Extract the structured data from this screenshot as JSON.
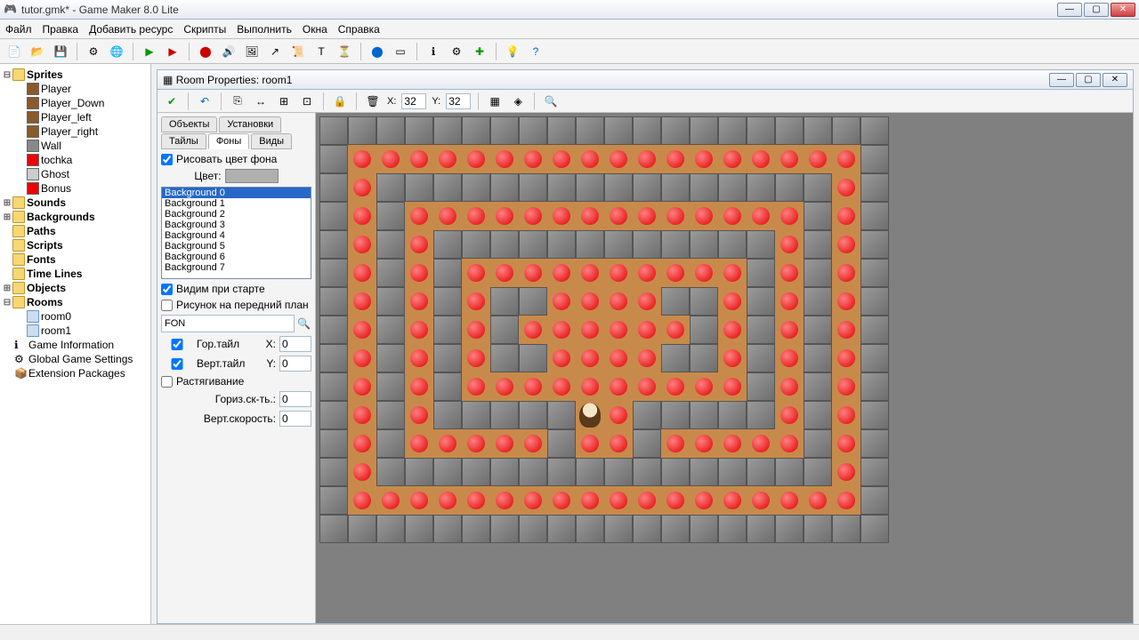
{
  "window": {
    "title": "tutor.gmk* - Game Maker 8.0 Lite"
  },
  "menu": [
    "Файл",
    "Правка",
    "Добавить ресурс",
    "Скрипты",
    "Выполнить",
    "Окна",
    "Справка"
  ],
  "tree": {
    "sprites": {
      "label": "Sprites",
      "items": [
        "Player",
        "Player_Down",
        "Player_left",
        "Player_right",
        "Wall",
        "tochka",
        "Ghost",
        "Bonus"
      ]
    },
    "sounds": "Sounds",
    "backgrounds": "Backgrounds",
    "paths": "Paths",
    "scripts": "Scripts",
    "fonts": "Fonts",
    "timelines": "Time Lines",
    "objects": "Objects",
    "rooms": {
      "label": "Rooms",
      "items": [
        "room0",
        "room1"
      ]
    },
    "gameinfo": "Game Information",
    "globalsettings": "Global Game Settings",
    "extensions": "Extension Packages"
  },
  "subwindow": {
    "title": "Room Properties: room1"
  },
  "roomtb": {
    "xlabel": "X:",
    "xval": "32",
    "ylabel": "Y:",
    "yval": "32"
  },
  "tabs": {
    "row1": [
      "Объекты",
      "Установки"
    ],
    "row2": [
      "Тайлы",
      "Фоны",
      "Виды"
    ],
    "active": "Фоны"
  },
  "props": {
    "drawbg": "Рисовать цвет фона",
    "colorlbl": "Цвет:",
    "bglist": [
      "Background 0",
      "Background 1",
      "Background 2",
      "Background 3",
      "Background 4",
      "Background 5",
      "Background 6",
      "Background 7"
    ],
    "bgsel": 0,
    "visible": "Видим при старте",
    "foreground": "Рисунок на передний план",
    "imgname": "FON",
    "htile": "Гор.тайл",
    "hx": "X:",
    "hxval": "0",
    "vtile": "Верт.тайл",
    "vy": "Y:",
    "vyval": "0",
    "stretch": "Растягивание",
    "hspeed": "Гориз.ск-ть.:",
    "hspeedval": "0",
    "vspeed": "Верт.скорость:",
    "vspeedval": "0"
  },
  "room_grid": {
    "cols": 20,
    "rows": 15,
    "walls": [
      [
        0,
        0
      ],
      [
        1,
        0
      ],
      [
        2,
        0
      ],
      [
        3,
        0
      ],
      [
        4,
        0
      ],
      [
        5,
        0
      ],
      [
        6,
        0
      ],
      [
        7,
        0
      ],
      [
        8,
        0
      ],
      [
        9,
        0
      ],
      [
        10,
        0
      ],
      [
        11,
        0
      ],
      [
        12,
        0
      ],
      [
        13,
        0
      ],
      [
        14,
        0
      ],
      [
        15,
        0
      ],
      [
        16,
        0
      ],
      [
        17,
        0
      ],
      [
        18,
        0
      ],
      [
        19,
        0
      ],
      [
        0,
        1
      ],
      [
        19,
        1
      ],
      [
        0,
        2
      ],
      [
        19,
        2
      ],
      [
        0,
        3
      ],
      [
        19,
        3
      ],
      [
        0,
        4
      ],
      [
        19,
        4
      ],
      [
        0,
        5
      ],
      [
        19,
        5
      ],
      [
        0,
        6
      ],
      [
        19,
        6
      ],
      [
        0,
        7
      ],
      [
        19,
        7
      ],
      [
        0,
        8
      ],
      [
        19,
        8
      ],
      [
        0,
        9
      ],
      [
        19,
        9
      ],
      [
        0,
        10
      ],
      [
        19,
        10
      ],
      [
        0,
        11
      ],
      [
        19,
        11
      ],
      [
        0,
        12
      ],
      [
        19,
        12
      ],
      [
        0,
        13
      ],
      [
        19,
        13
      ],
      [
        0,
        14
      ],
      [
        1,
        14
      ],
      [
        2,
        14
      ],
      [
        3,
        14
      ],
      [
        4,
        14
      ],
      [
        5,
        14
      ],
      [
        6,
        14
      ],
      [
        7,
        14
      ],
      [
        8,
        14
      ],
      [
        9,
        14
      ],
      [
        10,
        14
      ],
      [
        11,
        14
      ],
      [
        12,
        14
      ],
      [
        13,
        14
      ],
      [
        14,
        14
      ],
      [
        15,
        14
      ],
      [
        16,
        14
      ],
      [
        17,
        14
      ],
      [
        18,
        14
      ],
      [
        19,
        14
      ],
      [
        2,
        2
      ],
      [
        3,
        2
      ],
      [
        4,
        2
      ],
      [
        5,
        2
      ],
      [
        6,
        2
      ],
      [
        7,
        2
      ],
      [
        8,
        2
      ],
      [
        9,
        2
      ],
      [
        10,
        2
      ],
      [
        11,
        2
      ],
      [
        12,
        2
      ],
      [
        13,
        2
      ],
      [
        14,
        2
      ],
      [
        15,
        2
      ],
      [
        16,
        2
      ],
      [
        17,
        2
      ],
      [
        2,
        3
      ],
      [
        17,
        3
      ],
      [
        2,
        4
      ],
      [
        4,
        4
      ],
      [
        5,
        4
      ],
      [
        6,
        4
      ],
      [
        7,
        4
      ],
      [
        8,
        4
      ],
      [
        9,
        4
      ],
      [
        10,
        4
      ],
      [
        11,
        4
      ],
      [
        12,
        4
      ],
      [
        13,
        4
      ],
      [
        14,
        4
      ],
      [
        15,
        4
      ],
      [
        17,
        4
      ],
      [
        4,
        5
      ],
      [
        15,
        5
      ],
      [
        2,
        5
      ],
      [
        17,
        5
      ],
      [
        2,
        6
      ],
      [
        4,
        6
      ],
      [
        6,
        6
      ],
      [
        7,
        6
      ],
      [
        12,
        6
      ],
      [
        13,
        6
      ],
      [
        15,
        6
      ],
      [
        17,
        6
      ],
      [
        2,
        7
      ],
      [
        4,
        7
      ],
      [
        6,
        7
      ],
      [
        13,
        7
      ],
      [
        15,
        7
      ],
      [
        17,
        7
      ],
      [
        2,
        8
      ],
      [
        4,
        8
      ],
      [
        6,
        8
      ],
      [
        7,
        8
      ],
      [
        12,
        8
      ],
      [
        13,
        8
      ],
      [
        15,
        8
      ],
      [
        17,
        8
      ],
      [
        4,
        9
      ],
      [
        15,
        9
      ],
      [
        2,
        9
      ],
      [
        17,
        9
      ],
      [
        2,
        10
      ],
      [
        4,
        10
      ],
      [
        5,
        10
      ],
      [
        6,
        10
      ],
      [
        7,
        10
      ],
      [
        8,
        10
      ],
      [
        11,
        10
      ],
      [
        12,
        10
      ],
      [
        13,
        10
      ],
      [
        14,
        10
      ],
      [
        15,
        10
      ],
      [
        17,
        10
      ],
      [
        2,
        11
      ],
      [
        17,
        11
      ],
      [
        8,
        11
      ],
      [
        11,
        11
      ],
      [
        2,
        12
      ],
      [
        3,
        12
      ],
      [
        4,
        12
      ],
      [
        5,
        12
      ],
      [
        6,
        12
      ],
      [
        7,
        12
      ],
      [
        8,
        12
      ],
      [
        9,
        12
      ],
      [
        10,
        12
      ],
      [
        11,
        12
      ],
      [
        12,
        12
      ],
      [
        13,
        12
      ],
      [
        14,
        12
      ],
      [
        15,
        12
      ],
      [
        16,
        12
      ],
      [
        17,
        12
      ]
    ],
    "player": [
      9,
      10
    ]
  }
}
